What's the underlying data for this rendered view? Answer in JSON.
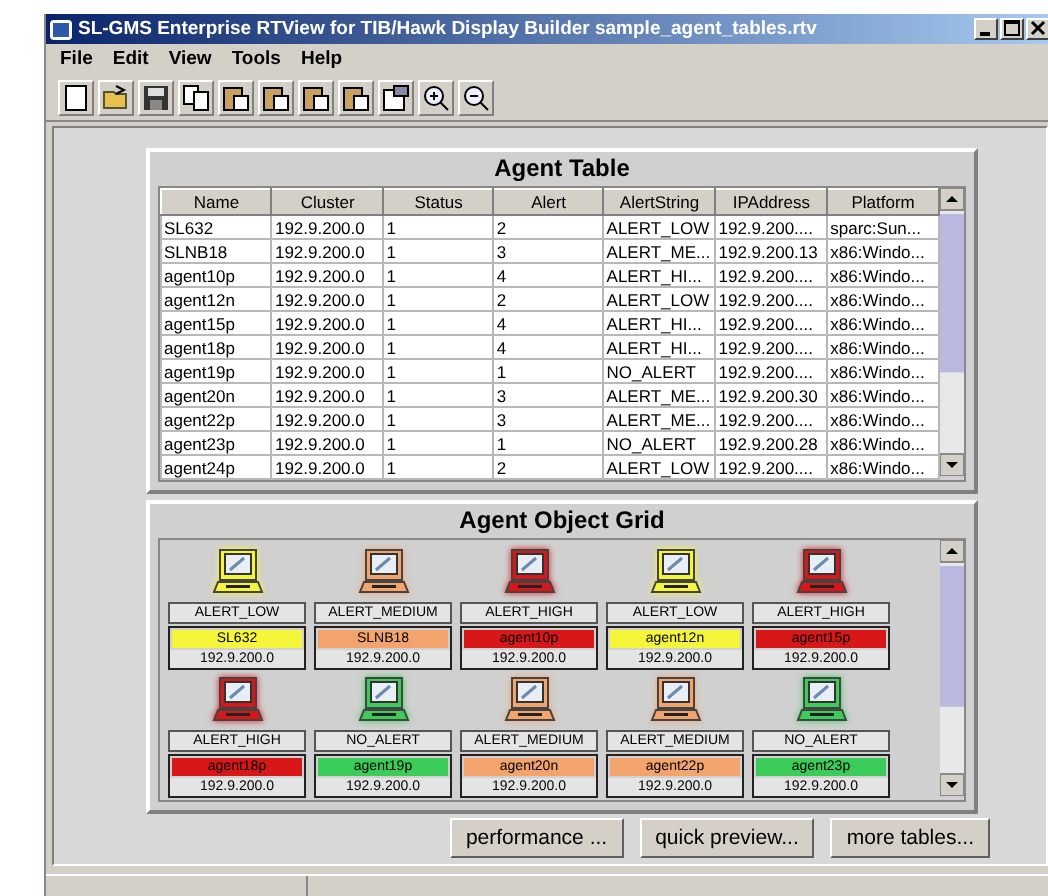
{
  "window": {
    "title": "SL-GMS Enterprise RTView for TIB/Hawk Display Builder sample_agent_tables.rtv"
  },
  "menu": [
    "File",
    "Edit",
    "View",
    "Tools",
    "Help"
  ],
  "toolbar": [
    {
      "kind": "new"
    },
    {
      "kind": "open"
    },
    {
      "kind": "save"
    },
    {
      "kind": "copy"
    },
    {
      "kind": "paste"
    },
    {
      "kind": "paste"
    },
    {
      "kind": "paste"
    },
    {
      "kind": "paste"
    },
    {
      "kind": "properties"
    },
    {
      "kind": "zoom-in"
    },
    {
      "kind": "zoom-out"
    }
  ],
  "agent_table": {
    "title": "Agent Table",
    "columns": [
      "Name",
      "Cluster",
      "Status",
      "Alert",
      "AlertString",
      "IPAddress",
      "Platform"
    ],
    "rows": [
      [
        "SL632",
        "192.9.200.0",
        "1",
        "2",
        "ALERT_LOW",
        "192.9.200....",
        "sparc:Sun..."
      ],
      [
        "SLNB18",
        "192.9.200.0",
        "1",
        "3",
        "ALERT_ME...",
        "192.9.200.13",
        "x86:Windo..."
      ],
      [
        "agent10p",
        "192.9.200.0",
        "1",
        "4",
        "ALERT_HI...",
        "192.9.200....",
        "x86:Windo..."
      ],
      [
        "agent12n",
        "192.9.200.0",
        "1",
        "2",
        "ALERT_LOW",
        "192.9.200....",
        "x86:Windo..."
      ],
      [
        "agent15p",
        "192.9.200.0",
        "1",
        "4",
        "ALERT_HI...",
        "192.9.200....",
        "x86:Windo..."
      ],
      [
        "agent18p",
        "192.9.200.0",
        "1",
        "4",
        "ALERT_HI...",
        "192.9.200....",
        "x86:Windo..."
      ],
      [
        "agent19p",
        "192.9.200.0",
        "1",
        "1",
        "NO_ALERT",
        "192.9.200....",
        "x86:Windo..."
      ],
      [
        "agent20n",
        "192.9.200.0",
        "1",
        "3",
        "ALERT_ME...",
        "192.9.200.30",
        "x86:Windo..."
      ],
      [
        "agent22p",
        "192.9.200.0",
        "1",
        "3",
        "ALERT_ME...",
        "192.9.200....",
        "x86:Windo..."
      ],
      [
        "agent23p",
        "192.9.200.0",
        "1",
        "1",
        "NO_ALERT",
        "192.9.200.28",
        "x86:Windo..."
      ],
      [
        "agent24p",
        "192.9.200.0",
        "1",
        "2",
        "ALERT_LOW",
        "192.9.200....",
        "x86:Windo..."
      ]
    ]
  },
  "object_grid": {
    "title": "Agent Object Grid",
    "items": [
      {
        "alert": "ALERT_LOW",
        "name": "SL632",
        "ip": "192.9.200.0",
        "color": "#f5f53a"
      },
      {
        "alert": "ALERT_MEDIUM",
        "name": "SLNB18",
        "ip": "192.9.200.0",
        "color": "#f2a46c"
      },
      {
        "alert": "ALERT_HIGH",
        "name": "agent10p",
        "ip": "192.9.200.0",
        "color": "#d81818"
      },
      {
        "alert": "ALERT_LOW",
        "name": "agent12n",
        "ip": "192.9.200.0",
        "color": "#f5f53a"
      },
      {
        "alert": "ALERT_HIGH",
        "name": "agent15p",
        "ip": "192.9.200.0",
        "color": "#d81818"
      },
      {
        "alert": "ALERT_HIGH",
        "name": "agent18p",
        "ip": "192.9.200.0",
        "color": "#d81818"
      },
      {
        "alert": "NO_ALERT",
        "name": "agent19p",
        "ip": "192.9.200.0",
        "color": "#3ccc5a"
      },
      {
        "alert": "ALERT_MEDIUM",
        "name": "agent20n",
        "ip": "192.9.200.0",
        "color": "#f2a46c"
      },
      {
        "alert": "ALERT_MEDIUM",
        "name": "agent22p",
        "ip": "192.9.200.0",
        "color": "#f2a46c"
      },
      {
        "alert": "NO_ALERT",
        "name": "agent23p",
        "ip": "192.9.200.0",
        "color": "#3ccc5a"
      }
    ]
  },
  "buttons": [
    "performance ...",
    "quick preview...",
    "more tables..."
  ]
}
